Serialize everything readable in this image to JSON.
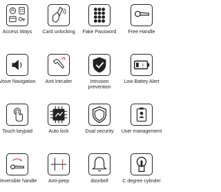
{
  "features": [
    {
      "label": "Access Ways",
      "icon": "access-ways-icon"
    },
    {
      "label": "Card unlocking",
      "icon": "card-icon"
    },
    {
      "label": "Fake Password",
      "icon": "keypad-icon"
    },
    {
      "label": "Free Handle",
      "icon": "handle-icon"
    },
    {
      "label": "Voive Navigation",
      "icon": "speaker-icon"
    },
    {
      "label": "Anti Intruder",
      "icon": "intruder-icon"
    },
    {
      "label": "Intrusion prevention",
      "icon": "shield-check-icon"
    },
    {
      "label": "Low Battey Alert",
      "icon": "battery-icon"
    },
    {
      "label": "Touch keypad",
      "icon": "touch-icon"
    },
    {
      "label": "Auto lock",
      "icon": "chip-icon"
    },
    {
      "label": "Dual security",
      "icon": "dual-shield-icon"
    },
    {
      "label": "User management",
      "icon": "user-badge-icon"
    },
    {
      "label": "Reversible handle",
      "icon": "reversible-icon"
    },
    {
      "label": "Anti-peep",
      "icon": "anti-peep-icon"
    },
    {
      "label": "doorbell",
      "icon": "bell-icon"
    },
    {
      "label": "C degree cylinder",
      "icon": "cylinder-icon"
    }
  ]
}
